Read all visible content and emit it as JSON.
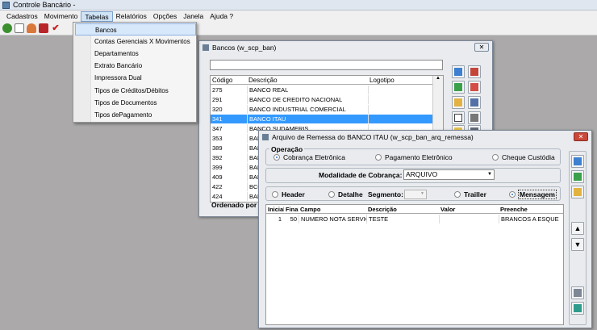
{
  "app": {
    "title": "Controle Bancário -"
  },
  "menu": [
    "Cadastros",
    "Movimento",
    "Tabelas",
    "Relatórios",
    "Opções",
    "Janela",
    "Ajuda ?"
  ],
  "menu_open_index": 2,
  "toolbar_icons": [
    "money-bag-icon",
    "document-icon",
    "person-icon",
    "car-icon",
    "checkmark-icon"
  ],
  "tabelas_menu": [
    "Bancos",
    "Contas Gerenciais X Movimentos",
    "Departamentos",
    "Extrato Bancário",
    "Impressora Dual",
    "Tipos de Créditos/Débitos",
    "Tipos de Documentos",
    "Tipos dePagamento"
  ],
  "bancos": {
    "title": "Bancos (w_scp_ban)",
    "search_value": "",
    "headers": {
      "codigo": "Código",
      "descricao": "Descrição",
      "logotipo": "Logotipo"
    },
    "rows": [
      {
        "codigo": "275",
        "descricao": "BANCO REAL"
      },
      {
        "codigo": "291",
        "descricao": "BANCO DE CREDITO NACIONAL"
      },
      {
        "codigo": "320",
        "descricao": "BANCO INDUSTRIAL COMERCIAL"
      },
      {
        "codigo": "341",
        "descricao": "BANCO ITAU"
      },
      {
        "codigo": "347",
        "descricao": "BANCO SUDAMERIS"
      },
      {
        "codigo": "353",
        "descricao": "BAN"
      },
      {
        "codigo": "389",
        "descricao": "BAN"
      },
      {
        "codigo": "392",
        "descricao": "BAN"
      },
      {
        "codigo": "399",
        "descricao": "BAN"
      },
      {
        "codigo": "409",
        "descricao": "BAN"
      },
      {
        "codigo": "422",
        "descricao": "BCO"
      },
      {
        "codigo": "424",
        "descricao": "BAN"
      }
    ],
    "selected_row": 3,
    "ordenado_label": "Ordenado por :"
  },
  "remessa": {
    "title": "Arquivo de Remessa do BANCO ITAU (w_scp_ban_arq_remessa)",
    "operacao_label": "Operação",
    "operacao_options": [
      "Cobrança Eletrônica",
      "Pagamento Eletrônico",
      "Cheque Custódia"
    ],
    "operacao_selected": 0,
    "modalidade_label": "Modalidade de Cobrança:",
    "modalidade_value": "ARQUIVO",
    "tipo_options": [
      "Header",
      "Detalhe",
      "Trailler",
      "Mensagem"
    ],
    "tipo_selected": 3,
    "segmento_label": "Segmento:",
    "segmento_value": "",
    "headers": {
      "inicial": "Inicial",
      "final": "Final",
      "campo": "Campo",
      "descricao": "Descrição",
      "valor": "Valor",
      "preenche": "Preenche"
    },
    "rows": [
      {
        "inicial": "1",
        "final": "50",
        "campo": "NUMERO NOTA SERVICO",
        "descricao": "TESTE",
        "valor": "",
        "preenche": "BRANCOS A ESQUE"
      }
    ]
  },
  "colors": {
    "selection": "#3399ff",
    "background": "#aba9a9",
    "close_red": "#c9483b"
  }
}
